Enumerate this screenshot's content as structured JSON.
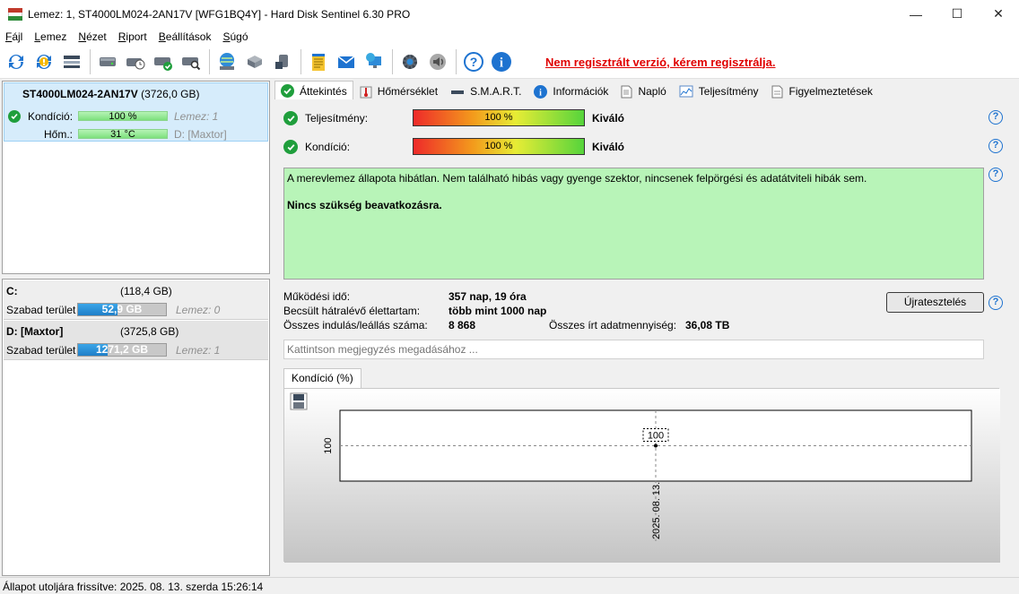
{
  "window": {
    "title": "Lemez: 1, ST4000LM024-2AN17V [WFG1BQ4Y]  -  Hard Disk Sentinel 6.30 PRO",
    "minimize": "—",
    "maximize": "☐",
    "close": "✕"
  },
  "menu": [
    {
      "ul": "F",
      "rest": "ájl"
    },
    {
      "ul": "L",
      "rest": "emez"
    },
    {
      "ul": "N",
      "rest": "ézet"
    },
    {
      "ul": "R",
      "rest": "iport"
    },
    {
      "ul": "B",
      "rest": "eállítások"
    },
    {
      "ul": "S",
      "rest": "úgó"
    }
  ],
  "toolbar": {
    "register_text": "Nem regisztrált verzió, kérem regisztrálja."
  },
  "disk": {
    "name": "ST4000LM024-2AN17V",
    "size": "(3726,0 GB)",
    "health_label": "Kondíció:",
    "health_value": "100 %",
    "health_pct": 100,
    "disk_label": "Lemez: 1",
    "temp_label": "Hőm.:",
    "temp_value": "31 °C",
    "drive_letter": "D:",
    "drive_name": "[Maxtor]"
  },
  "partitions": [
    {
      "name": "C:",
      "size": "(118,4 GB)",
      "free_label": "Szabad terület",
      "free_value": "52,9 GB",
      "free_fraction": 0.447,
      "disk": "Lemez: 0"
    },
    {
      "name": "D: [Maxtor]",
      "size": "(3725,8 GB)",
      "free_label": "Szabad terület",
      "free_value": "1271,2 GB",
      "free_fraction": 0.341,
      "disk": "Lemez: 1"
    }
  ],
  "tabs": [
    {
      "label": "Áttekintés",
      "icon": "check-icon"
    },
    {
      "label": "Hőmérséklet",
      "icon": "thermometer-icon"
    },
    {
      "label": "S.M.A.R.T.",
      "icon": "drive-icon"
    },
    {
      "label": "Információk",
      "icon": "info-icon"
    },
    {
      "label": "Napló",
      "icon": "log-icon"
    },
    {
      "label": "Teljesítmény",
      "icon": "performance-icon"
    },
    {
      "label": "Figyelmeztetések",
      "icon": "alerts-icon"
    }
  ],
  "overview": {
    "performance_label": "Teljesítmény:",
    "performance_value": "100 %",
    "performance_verdict": "Kiváló",
    "health_label": "Kondíció:",
    "health_value": "100 %",
    "health_verdict": "Kiváló",
    "summary_text": "A merevlemez állapota hibátlan. Nem található hibás vagy gyenge szektor, nincsenek felpörgési és adatátviteli hibák sem.",
    "summary_action": "Nincs szükség beavatkozásra.",
    "power_on_label": "Működési idő:",
    "power_on_value": "357 nap, 19 óra",
    "lifetime_label": "Becsült hátralévő élettartam:",
    "lifetime_value": "több mint 1000 nap",
    "starts_label": "Összes indulás/leállás száma:",
    "starts_value": "8 868",
    "written_label": "Összes írt adatmennyiség:",
    "written_value": "36,08 TB",
    "retest_button": "Újratesztelés",
    "note_placeholder": "Kattintson megjegyzés megadásához ..."
  },
  "chart_tab": "Kondíció  (%)",
  "chart_data": {
    "type": "line",
    "x": [
      "2025. 08. 13."
    ],
    "series": [
      {
        "values": [
          100
        ]
      }
    ],
    "ylabel": "",
    "xlabel": "",
    "y_tick_labels": [
      "100"
    ],
    "data_labels": [
      "100"
    ],
    "grid": true
  },
  "statusbar": {
    "text": "Állapot utoljára frissítve: 2025. 08. 13. szerda 15:26:14"
  }
}
